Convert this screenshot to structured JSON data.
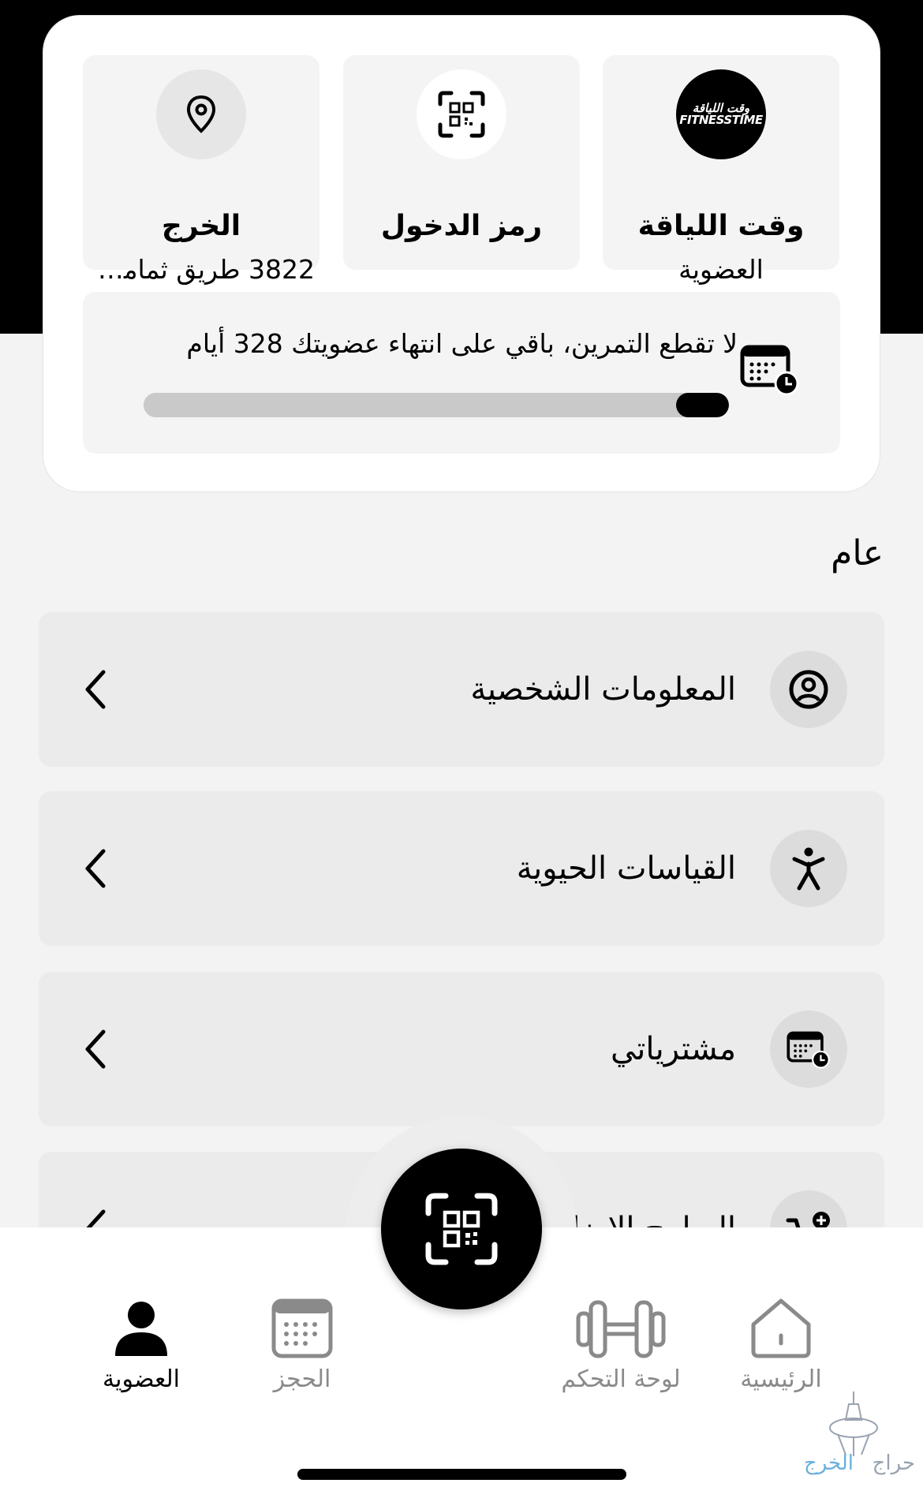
{
  "membership": {
    "gym": {
      "title": "وقت اللياقة",
      "subtitle": "العضوية",
      "logo_text": "وقت اللياقة FITNESSTIME"
    },
    "qr": {
      "title": "رمز الدخول",
      "icon": "qr-code-icon"
    },
    "location": {
      "title": "الخرج",
      "subtitle": "3822 طريق ثمامة ...",
      "icon": "map-pin-icon"
    },
    "progress": {
      "text": "لا تقطع التمرين، باقي على انتهاء عضويتك  328 أيام",
      "fraction_remaining": 0.09,
      "icon": "calendar-clock-icon"
    }
  },
  "section": {
    "title": "عام"
  },
  "rows": [
    {
      "label": "المعلومات الشخصية",
      "icon": "user-circle-icon"
    },
    {
      "label": "القياسات الحيوية",
      "icon": "body-figure-icon"
    },
    {
      "label": "مشترياتي",
      "icon": "calendar-clock-icon"
    },
    {
      "label": "البرامج الاضافية",
      "icon": "cart-plus-icon"
    }
  ],
  "tabbar": {
    "home": "الرئيسية",
    "dashboard": "لوحة التحكم",
    "booking": "الحجز",
    "membership": "العضوية",
    "scan_icon": "qr-scan-icon"
  },
  "watermark": {
    "word1": "حراج",
    "word2": "الخرج"
  },
  "colors": {
    "accent": "#000000",
    "inactive": "#8a8a8a",
    "tile_bg": "#f4f4f4",
    "row_bg": "#ebebeb"
  }
}
